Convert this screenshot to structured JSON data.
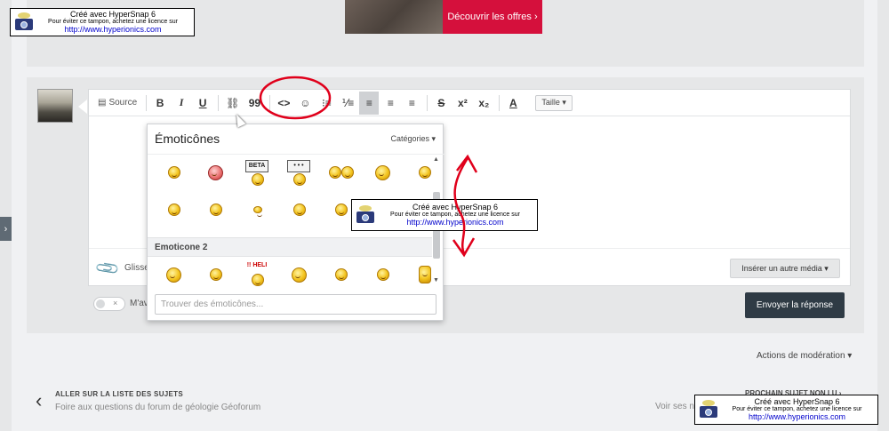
{
  "ad": {
    "cta": "Découvrir les offres ›"
  },
  "side_tab": {
    "icon": "›"
  },
  "stamp": {
    "line1": "Créé avec HyperSnap 6",
    "line2": "Pour éviter ce tampon, achetez une licence sur",
    "line3": "http://www.hyperionics.com"
  },
  "toolbar": {
    "source": "Source",
    "bold": "B",
    "italic": "I",
    "underline": "U",
    "link": "⛓",
    "quote": "99",
    "code": "<>",
    "smilies": "☺",
    "bullets": "⁝≡",
    "numbers": "⅟≡",
    "align_left": "≡",
    "align_center": "≡",
    "align_right": "≡",
    "strike": "S",
    "superscript": "x²",
    "subscript": "x₂",
    "font_color": "A",
    "size": "Taille ▾"
  },
  "emoticons": {
    "title": "Émoticônes",
    "categories": "Catégories ▾",
    "section2": "Emoticone 2",
    "search_placeholder": "Trouver des émoticônes...",
    "beta_sign": "BETA",
    "dots_sign": "• • •",
    "heli_sign": "!! HELI"
  },
  "editor": {
    "drop_label": "Glisse",
    "insert_media": "Insérer un autre média ▾",
    "toggle_label": "M'av",
    "toggle_x": "×",
    "send": "Envoyer la réponse"
  },
  "footer": {
    "moderation": "Actions de modération ▾",
    "back_chevron": "‹",
    "back_title": "ALLER SUR LA LISTE DES SUJETS",
    "back_sub": "Foire aux questions du forum de géologie Géoforum",
    "next_title": "PROCHAIN SUJET NON LU ›",
    "next_sub": "Voir ses n"
  },
  "colors": {
    "ad_red": "#d5103c",
    "send_button": "#2f3b45",
    "annotation_red": "#e0001b"
  }
}
